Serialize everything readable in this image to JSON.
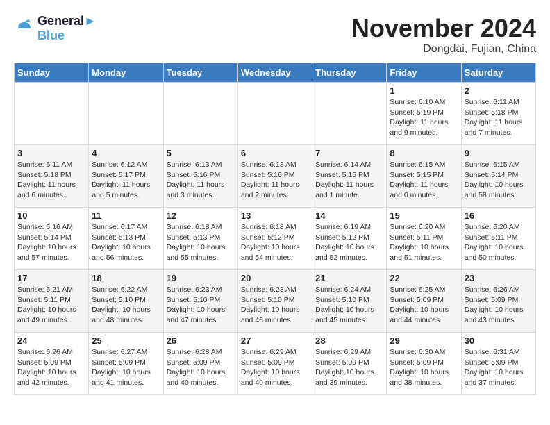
{
  "logo": {
    "line1": "General",
    "line2": "Blue"
  },
  "title": "November 2024",
  "location": "Dongdai, Fujian, China",
  "weekdays": [
    "Sunday",
    "Monday",
    "Tuesday",
    "Wednesday",
    "Thursday",
    "Friday",
    "Saturday"
  ],
  "weeks": [
    [
      {
        "day": "",
        "sunrise": "",
        "sunset": "",
        "daylight": ""
      },
      {
        "day": "",
        "sunrise": "",
        "sunset": "",
        "daylight": ""
      },
      {
        "day": "",
        "sunrise": "",
        "sunset": "",
        "daylight": ""
      },
      {
        "day": "",
        "sunrise": "",
        "sunset": "",
        "daylight": ""
      },
      {
        "day": "",
        "sunrise": "",
        "sunset": "",
        "daylight": ""
      },
      {
        "day": "1",
        "sunrise": "Sunrise: 6:10 AM",
        "sunset": "Sunset: 5:19 PM",
        "daylight": "Daylight: 11 hours and 9 minutes."
      },
      {
        "day": "2",
        "sunrise": "Sunrise: 6:11 AM",
        "sunset": "Sunset: 5:18 PM",
        "daylight": "Daylight: 11 hours and 7 minutes."
      }
    ],
    [
      {
        "day": "3",
        "sunrise": "Sunrise: 6:11 AM",
        "sunset": "Sunset: 5:18 PM",
        "daylight": "Daylight: 11 hours and 6 minutes."
      },
      {
        "day": "4",
        "sunrise": "Sunrise: 6:12 AM",
        "sunset": "Sunset: 5:17 PM",
        "daylight": "Daylight: 11 hours and 5 minutes."
      },
      {
        "day": "5",
        "sunrise": "Sunrise: 6:13 AM",
        "sunset": "Sunset: 5:16 PM",
        "daylight": "Daylight: 11 hours and 3 minutes."
      },
      {
        "day": "6",
        "sunrise": "Sunrise: 6:13 AM",
        "sunset": "Sunset: 5:16 PM",
        "daylight": "Daylight: 11 hours and 2 minutes."
      },
      {
        "day": "7",
        "sunrise": "Sunrise: 6:14 AM",
        "sunset": "Sunset: 5:15 PM",
        "daylight": "Daylight: 11 hours and 1 minute."
      },
      {
        "day": "8",
        "sunrise": "Sunrise: 6:15 AM",
        "sunset": "Sunset: 5:15 PM",
        "daylight": "Daylight: 11 hours and 0 minutes."
      },
      {
        "day": "9",
        "sunrise": "Sunrise: 6:15 AM",
        "sunset": "Sunset: 5:14 PM",
        "daylight": "Daylight: 10 hours and 58 minutes."
      }
    ],
    [
      {
        "day": "10",
        "sunrise": "Sunrise: 6:16 AM",
        "sunset": "Sunset: 5:14 PM",
        "daylight": "Daylight: 10 hours and 57 minutes."
      },
      {
        "day": "11",
        "sunrise": "Sunrise: 6:17 AM",
        "sunset": "Sunset: 5:13 PM",
        "daylight": "Daylight: 10 hours and 56 minutes."
      },
      {
        "day": "12",
        "sunrise": "Sunrise: 6:18 AM",
        "sunset": "Sunset: 5:13 PM",
        "daylight": "Daylight: 10 hours and 55 minutes."
      },
      {
        "day": "13",
        "sunrise": "Sunrise: 6:18 AM",
        "sunset": "Sunset: 5:12 PM",
        "daylight": "Daylight: 10 hours and 54 minutes."
      },
      {
        "day": "14",
        "sunrise": "Sunrise: 6:19 AM",
        "sunset": "Sunset: 5:12 PM",
        "daylight": "Daylight: 10 hours and 52 minutes."
      },
      {
        "day": "15",
        "sunrise": "Sunrise: 6:20 AM",
        "sunset": "Sunset: 5:11 PM",
        "daylight": "Daylight: 10 hours and 51 minutes."
      },
      {
        "day": "16",
        "sunrise": "Sunrise: 6:20 AM",
        "sunset": "Sunset: 5:11 PM",
        "daylight": "Daylight: 10 hours and 50 minutes."
      }
    ],
    [
      {
        "day": "17",
        "sunrise": "Sunrise: 6:21 AM",
        "sunset": "Sunset: 5:11 PM",
        "daylight": "Daylight: 10 hours and 49 minutes."
      },
      {
        "day": "18",
        "sunrise": "Sunrise: 6:22 AM",
        "sunset": "Sunset: 5:10 PM",
        "daylight": "Daylight: 10 hours and 48 minutes."
      },
      {
        "day": "19",
        "sunrise": "Sunrise: 6:23 AM",
        "sunset": "Sunset: 5:10 PM",
        "daylight": "Daylight: 10 hours and 47 minutes."
      },
      {
        "day": "20",
        "sunrise": "Sunrise: 6:23 AM",
        "sunset": "Sunset: 5:10 PM",
        "daylight": "Daylight: 10 hours and 46 minutes."
      },
      {
        "day": "21",
        "sunrise": "Sunrise: 6:24 AM",
        "sunset": "Sunset: 5:10 PM",
        "daylight": "Daylight: 10 hours and 45 minutes."
      },
      {
        "day": "22",
        "sunrise": "Sunrise: 6:25 AM",
        "sunset": "Sunset: 5:09 PM",
        "daylight": "Daylight: 10 hours and 44 minutes."
      },
      {
        "day": "23",
        "sunrise": "Sunrise: 6:26 AM",
        "sunset": "Sunset: 5:09 PM",
        "daylight": "Daylight: 10 hours and 43 minutes."
      }
    ],
    [
      {
        "day": "24",
        "sunrise": "Sunrise: 6:26 AM",
        "sunset": "Sunset: 5:09 PM",
        "daylight": "Daylight: 10 hours and 42 minutes."
      },
      {
        "day": "25",
        "sunrise": "Sunrise: 6:27 AM",
        "sunset": "Sunset: 5:09 PM",
        "daylight": "Daylight: 10 hours and 41 minutes."
      },
      {
        "day": "26",
        "sunrise": "Sunrise: 6:28 AM",
        "sunset": "Sunset: 5:09 PM",
        "daylight": "Daylight: 10 hours and 40 minutes."
      },
      {
        "day": "27",
        "sunrise": "Sunrise: 6:29 AM",
        "sunset": "Sunset: 5:09 PM",
        "daylight": "Daylight: 10 hours and 40 minutes."
      },
      {
        "day": "28",
        "sunrise": "Sunrise: 6:29 AM",
        "sunset": "Sunset: 5:09 PM",
        "daylight": "Daylight: 10 hours and 39 minutes."
      },
      {
        "day": "29",
        "sunrise": "Sunrise: 6:30 AM",
        "sunset": "Sunset: 5:09 PM",
        "daylight": "Daylight: 10 hours and 38 minutes."
      },
      {
        "day": "30",
        "sunrise": "Sunrise: 6:31 AM",
        "sunset": "Sunset: 5:09 PM",
        "daylight": "Daylight: 10 hours and 37 minutes."
      }
    ]
  ]
}
